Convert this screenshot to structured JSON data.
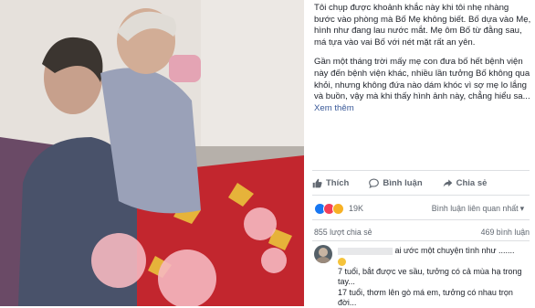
{
  "post": {
    "paragraph1": "Tôi chụp được khoảnh khắc này khi tôi nhẹ nhàng bước vào phòng mà Bố Mẹ không biết. Bố dựa vào Mẹ, hình như đang lau nước mắt. Mẹ ôm Bố từ đằng sau, má tựa vào vai Bố với nét mặt rất an yên.",
    "paragraph2": "Gần một tháng trời mấy mẹ con đưa bố hết bệnh viện này đến bệnh viện khác, nhiều lần tưởng Bố không qua khỏi, nhưng không đứa nào dám khóc vì sợ mẹ lo lắng và buồn, vậy mà khi thấy hình ảnh này, chẳng hiểu sa...",
    "see_more": "Xem thêm"
  },
  "actions": {
    "like": "Thích",
    "comment": "Bình luận",
    "share": "Chia sẻ"
  },
  "reactions": {
    "count": "19K",
    "sort_label": "Bình luận liên quan nhất"
  },
  "stats": {
    "shares": "855 lượt chia sẻ",
    "comments": "469 bình luận"
  },
  "comment": {
    "line1": "ai ước một chuyện tình như .......",
    "line2": "7 tuổi, bắt được ve sầu, tưởng có cả mùa hạ trong",
    "line3": "tay...",
    "line4": "17 tuổi, thơm lên gò má em, tưởng có nhau trọn",
    "line5": "đời..."
  },
  "colors": {
    "link": "#385898",
    "text": "#1d2129",
    "muted": "#606770",
    "like": "#1877f2",
    "love": "#f33e58",
    "haha": "#f7b125"
  },
  "icons": {
    "like": "thumbs-up-icon",
    "comment": "comment-bubble-icon",
    "share": "share-arrow-icon"
  }
}
